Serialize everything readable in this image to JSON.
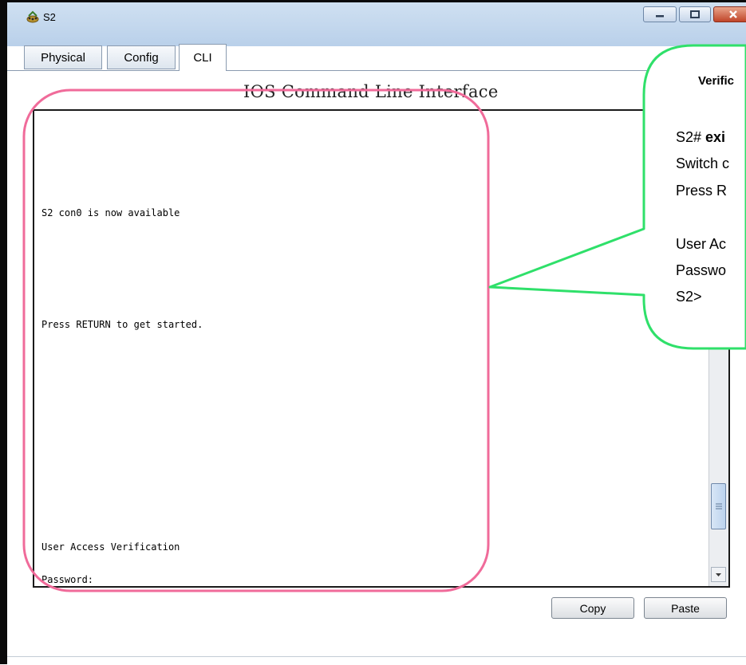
{
  "window": {
    "title": "S2",
    "title_icon": "network-device-icon"
  },
  "tabs": [
    {
      "label": "Physical"
    },
    {
      "label": "Config"
    },
    {
      "label": "CLI"
    }
  ],
  "cli": {
    "heading": "IOS Command Line Interface",
    "lines": [
      "S2 con0 is now available",
      "Press RETURN to get started.",
      "User Access Verification",
      "Password:"
    ]
  },
  "buttons": {
    "copy": "Copy",
    "paste": "Paste"
  },
  "callout": {
    "title": "Verific",
    "lines": [
      {
        "prefix": "S2# ",
        "bold": "exi"
      },
      {
        "text": "Switch c"
      },
      {
        "text": "Press R"
      },
      {
        "text": "User Ac"
      },
      {
        "text": "Passwo"
      },
      {
        "text": "S2>"
      }
    ],
    "border_color": "#2fe06a"
  },
  "highlight": {
    "border_color": "#f06b9a"
  }
}
